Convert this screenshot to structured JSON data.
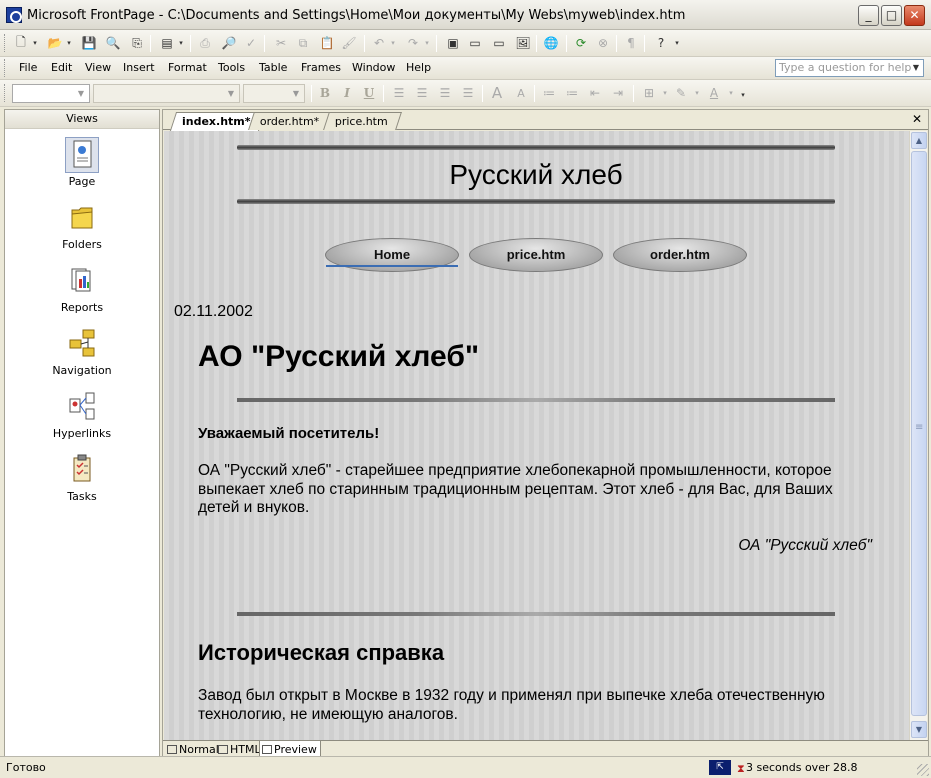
{
  "window": {
    "title": "Microsoft FrontPage - C:\\Documents and Settings\\Home\\Мои документы\\My Webs\\myweb\\index.htm"
  },
  "menu": [
    "File",
    "Edit",
    "View",
    "Insert",
    "Format",
    "Tools",
    "Table",
    "Frames",
    "Window",
    "Help"
  ],
  "help_box": {
    "placeholder": "Type a question for help"
  },
  "views": {
    "header": "Views",
    "items": [
      {
        "label": "Page",
        "icon": "page-view-icon",
        "selected": true
      },
      {
        "label": "Folders",
        "icon": "folder-icon"
      },
      {
        "label": "Reports",
        "icon": "reports-icon"
      },
      {
        "label": "Navigation",
        "icon": "navigation-icon"
      },
      {
        "label": "Hyperlinks",
        "icon": "hyperlinks-icon"
      },
      {
        "label": "Tasks",
        "icon": "tasks-icon"
      }
    ]
  },
  "doc_tabs": [
    "index.htm*",
    "order.htm*",
    "price.htm"
  ],
  "view_tabs": [
    "Normal",
    "HTML",
    "Preview"
  ],
  "page": {
    "banner": "Русский хлеб",
    "nav": [
      "Home",
      "price.htm",
      "order.htm"
    ],
    "date": "02.11.2002",
    "heading": "АО \"Русский хлеб\"",
    "greeting": "Уважаемый  посетитель!",
    "paragraph1": "ОА \"Русский  хлеб\" - старейшее предприятие хлебопекарной промышленности, которое выпекает хлеб по старинным традиционным рецептам. Этот хлеб - для Вас, для Ваших детей и внуков.",
    "signature": "ОА \"Русский хлеб\"",
    "heading2": "Историческая справка",
    "paragraph2": "Завод был открыт в Москве в 1932 году и применял при выпечке хлеба отечественную технологию, не имеющую аналогов."
  },
  "status": {
    "text": "Готово",
    "time": "3 seconds over 28.8"
  }
}
